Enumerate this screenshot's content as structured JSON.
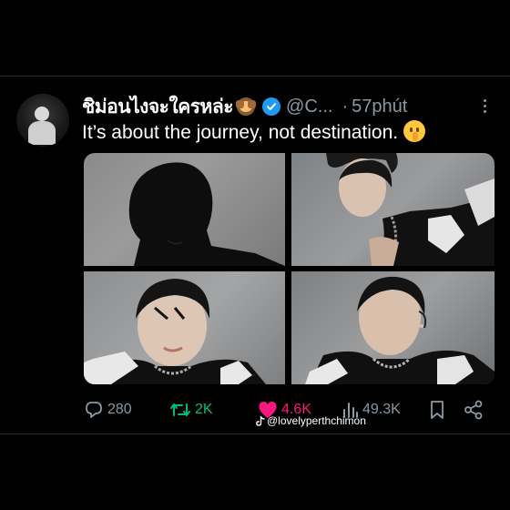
{
  "tweet": {
    "display_name": "ชิม่อนไงจะใครหล่ะ",
    "handle": "@C...",
    "separator": "·",
    "time": "57phút",
    "text": "It’s about the journey, not destination."
  },
  "actions": {
    "replies": "280",
    "retweets": "2K",
    "likes": "4.6K",
    "views": "49.3K"
  },
  "watermark": {
    "text": "@lovelyperthchimon"
  },
  "colors": {
    "background": "#000000",
    "text": "#e7e9ea",
    "muted": "#8b98a5",
    "verified": "#1d9bf0",
    "retweet": "#00ba7c",
    "like": "#f91880"
  },
  "icons": [
    "reply-icon",
    "retweet-icon",
    "like-icon",
    "views-icon",
    "bookmark-icon",
    "share-icon",
    "verified-icon",
    "more-icon"
  ]
}
